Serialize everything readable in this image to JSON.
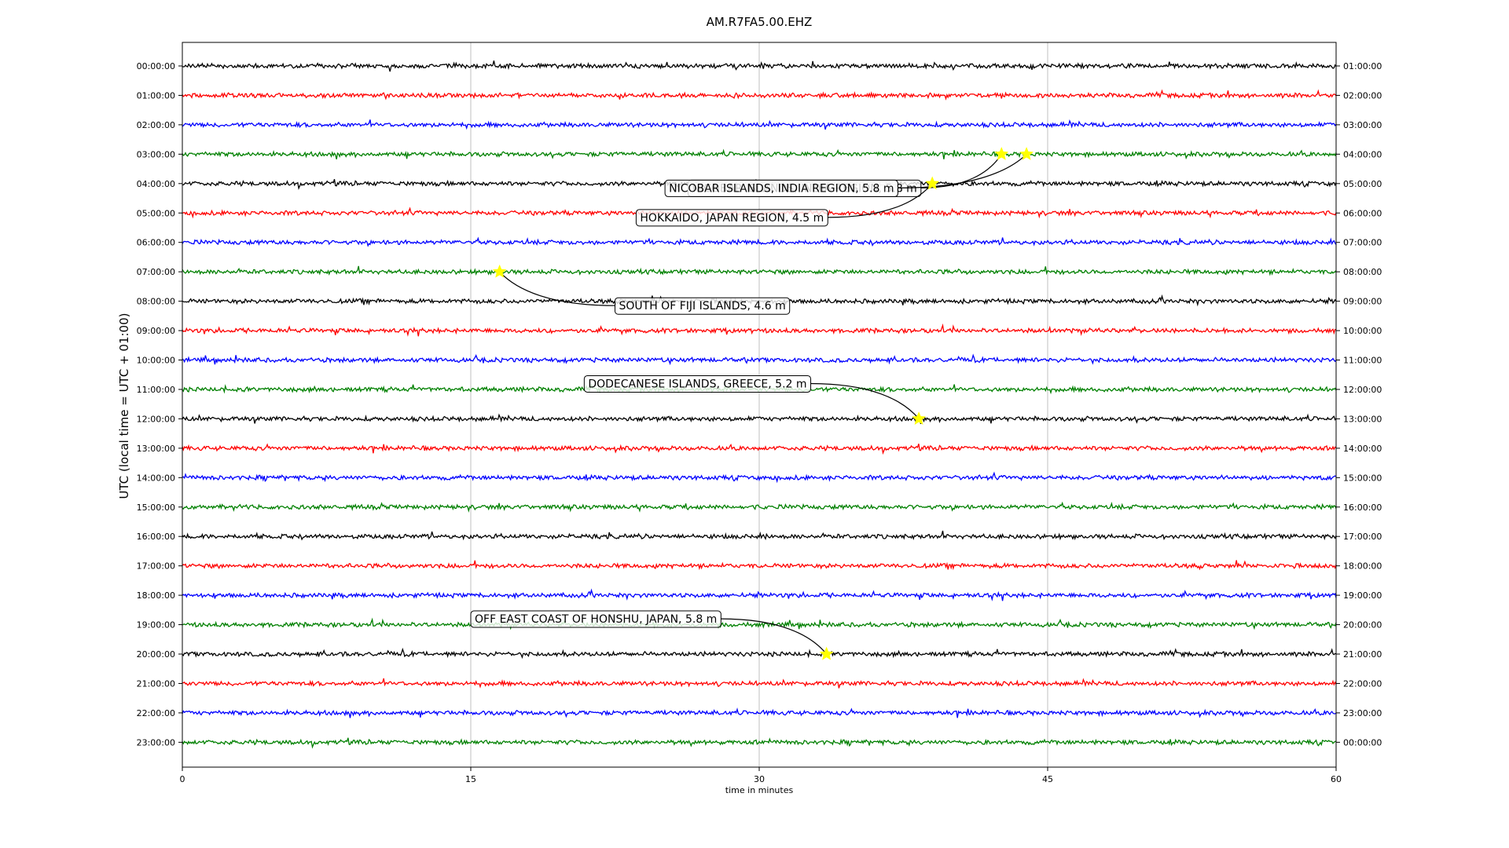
{
  "chart_data": {
    "type": "line",
    "title": "AM.R7FA5.00.EHZ",
    "xlabel": "time in minutes",
    "ylabel": "UTC (local time = UTC + 01:00)",
    "xlim": [
      0,
      60
    ],
    "xticks": [
      "0",
      "15",
      "30",
      "45",
      "60"
    ],
    "grid": "vertical",
    "series": [
      {
        "utc": "00:00:00",
        "local": "01:00:00",
        "color": "#000000"
      },
      {
        "utc": "01:00:00",
        "local": "02:00:00",
        "color": "#ff0000"
      },
      {
        "utc": "02:00:00",
        "local": "03:00:00",
        "color": "#0000ff"
      },
      {
        "utc": "03:00:00",
        "local": "04:00:00",
        "color": "#008000"
      },
      {
        "utc": "04:00:00",
        "local": "05:00:00",
        "color": "#000000"
      },
      {
        "utc": "05:00:00",
        "local": "06:00:00",
        "color": "#ff0000"
      },
      {
        "utc": "06:00:00",
        "local": "07:00:00",
        "color": "#0000ff"
      },
      {
        "utc": "07:00:00",
        "local": "08:00:00",
        "color": "#008000"
      },
      {
        "utc": "08:00:00",
        "local": "09:00:00",
        "color": "#000000"
      },
      {
        "utc": "09:00:00",
        "local": "10:00:00",
        "color": "#ff0000"
      },
      {
        "utc": "10:00:00",
        "local": "11:00:00",
        "color": "#0000ff"
      },
      {
        "utc": "11:00:00",
        "local": "12:00:00",
        "color": "#008000"
      },
      {
        "utc": "12:00:00",
        "local": "13:00:00",
        "color": "#000000"
      },
      {
        "utc": "13:00:00",
        "local": "14:00:00",
        "color": "#ff0000"
      },
      {
        "utc": "14:00:00",
        "local": "15:00:00",
        "color": "#0000ff"
      },
      {
        "utc": "15:00:00",
        "local": "16:00:00",
        "color": "#008000"
      },
      {
        "utc": "16:00:00",
        "local": "17:00:00",
        "color": "#000000"
      },
      {
        "utc": "17:00:00",
        "local": "18:00:00",
        "color": "#ff0000"
      },
      {
        "utc": "18:00:00",
        "local": "19:00:00",
        "color": "#0000ff"
      },
      {
        "utc": "19:00:00",
        "local": "20:00:00",
        "color": "#008000"
      },
      {
        "utc": "20:00:00",
        "local": "21:00:00",
        "color": "#000000"
      },
      {
        "utc": "21:00:00",
        "local": "22:00:00",
        "color": "#ff0000"
      },
      {
        "utc": "22:00:00",
        "local": "23:00:00",
        "color": "#0000ff"
      },
      {
        "utc": "23:00:00",
        "local": "00:00:00",
        "color": "#008000"
      }
    ],
    "events": [
      {
        "label": "NICOBAR ISLANDS, INDIA REGION, 5.8 m",
        "row": 3,
        "minute": 42.6,
        "label_row": 4.15,
        "label_minute": 26.3
      },
      {
        "label": "NICOBAR ISLANDS, INDIA REGION, 5.8 m",
        "row": 3,
        "minute": 43.9,
        "label_row": 4.15,
        "label_minute": 25.1
      },
      {
        "label": "HOKKAIDO, JAPAN REGION, 4.5 m",
        "row": 4,
        "minute": 39.0,
        "label_row": 5.15,
        "label_minute": 23.6
      },
      {
        "label": "SOUTH OF FIJI ISLANDS, 4.6 m",
        "row": 7,
        "minute": 16.5,
        "label_row": 8.15,
        "label_minute": 22.5
      },
      {
        "label": "DODECANESE ISLANDS, GREECE, 5.2 m",
        "row": 12,
        "minute": 38.3,
        "label_row": 10.8,
        "label_minute": 20.9
      },
      {
        "label": "OFF EAST COAST OF HONSHU, JAPAN, 5.8 m",
        "row": 20,
        "minute": 33.5,
        "label_row": 18.8,
        "label_minute": 15.0
      }
    ],
    "marker_color": "#ffff00"
  }
}
